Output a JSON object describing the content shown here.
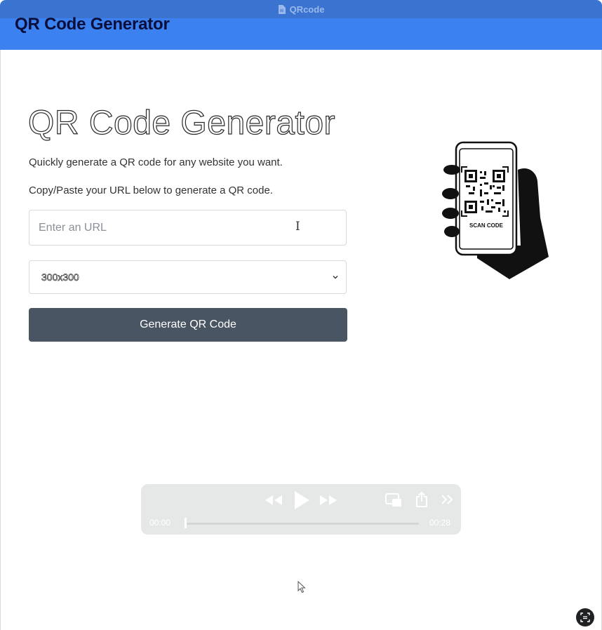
{
  "window": {
    "title": "QRcode",
    "icon": "document-icon"
  },
  "header": {
    "title": "QR Code Generator"
  },
  "hero": {
    "title": "QR Code Generator",
    "line1": "Quickly generate a QR code for any website you want.",
    "line2": "Copy/Paste your URL below to generate a QR code."
  },
  "form": {
    "url_placeholder": "Enter an URL",
    "url_value": "",
    "size_selected": "300x300",
    "generate_label": "Generate QR Code"
  },
  "illustration": {
    "caption": "SCAN CODE",
    "icon": "phone-qr-hand-icon"
  },
  "media": {
    "time_current": "00:00",
    "time_total": "00:28",
    "progress": 0
  },
  "colors": {
    "titlebar": "#3b74d0",
    "header": "#3b82f0",
    "button": "#4a5563"
  }
}
